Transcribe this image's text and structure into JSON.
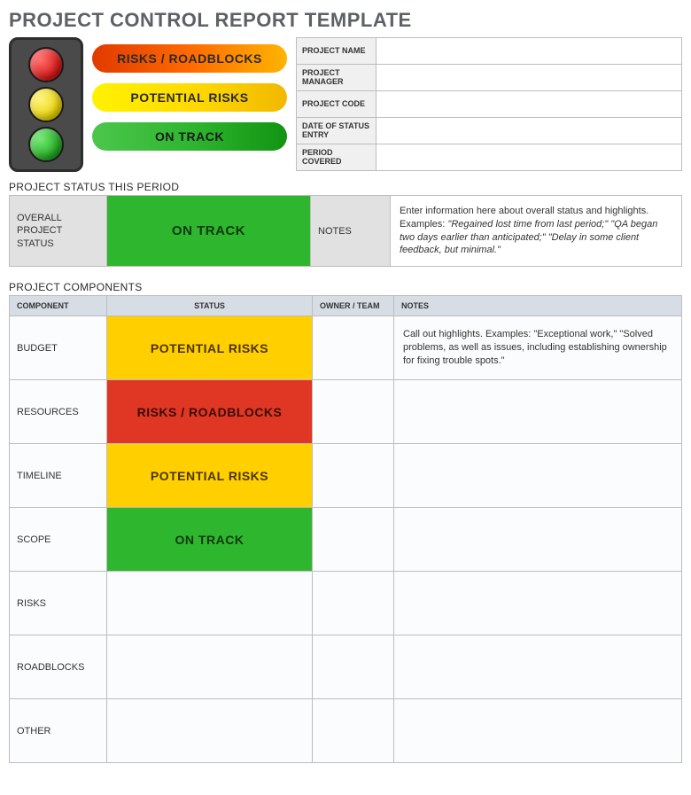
{
  "title": "PROJECT CONTROL REPORT TEMPLATE",
  "legend": {
    "risks": "RISKS / ROADBLOCKS",
    "potential": "POTENTIAL RISKS",
    "ontrack": "ON TRACK"
  },
  "meta": [
    {
      "label": "PROJECT NAME",
      "value": ""
    },
    {
      "label": "PROJECT MANAGER",
      "value": ""
    },
    {
      "label": "PROJECT CODE",
      "value": ""
    },
    {
      "label": "DATE OF STATUS ENTRY",
      "value": ""
    },
    {
      "label": "PERIOD COVERED",
      "value": ""
    }
  ],
  "status_section": {
    "heading": "PROJECT STATUS THIS PERIOD",
    "overall_label": "OVERALL PROJECT STATUS",
    "overall_status_text": "ON TRACK",
    "overall_status_kind": "ontrack",
    "notes_label": "NOTES",
    "notes_lead": "Enter information here about overall status and highlights. Examples: ",
    "notes_examples": "\"Regained lost time from last period;\" \"QA began two days earlier than anticipated;\" \"Delay in some client feedback, but minimal.\""
  },
  "components_section": {
    "heading": "PROJECT COMPONENTS",
    "headers": {
      "component": "COMPONENT",
      "status": "STATUS",
      "owner": "OWNER / TEAM",
      "notes": "NOTES"
    },
    "rows": [
      {
        "component": "BUDGET",
        "status_text": "POTENTIAL RISKS",
        "status_kind": "potential",
        "owner": "",
        "notes": "Call out highlights. Examples: \"Exceptional work,\" \"Solved problems, as well as issues, including establishing ownership for fixing trouble spots.\""
      },
      {
        "component": "RESOURCES",
        "status_text": "RISKS / ROADBLOCKS",
        "status_kind": "risks",
        "owner": "",
        "notes": ""
      },
      {
        "component": "TIMELINE",
        "status_text": "POTENTIAL RISKS",
        "status_kind": "potential",
        "owner": "",
        "notes": ""
      },
      {
        "component": "SCOPE",
        "status_text": "ON TRACK",
        "status_kind": "ontrack",
        "owner": "",
        "notes": ""
      },
      {
        "component": "RISKS",
        "status_text": "",
        "status_kind": "none",
        "owner": "",
        "notes": ""
      },
      {
        "component": "ROADBLOCKS",
        "status_text": "",
        "status_kind": "none",
        "owner": "",
        "notes": ""
      },
      {
        "component": "OTHER",
        "status_text": "",
        "status_kind": "none",
        "owner": "",
        "notes": ""
      }
    ]
  }
}
